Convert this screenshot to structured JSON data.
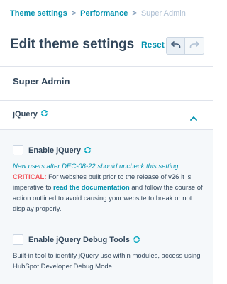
{
  "breadcrumb": {
    "items": [
      "Theme settings",
      "Performance",
      "Super Admin"
    ],
    "separator": ">"
  },
  "header": {
    "title": "Edit theme settings",
    "reset_label": "Reset",
    "undo_icon": "undo-icon",
    "redo_icon": "redo-icon"
  },
  "section": {
    "title": "Super Admin"
  },
  "accordion": {
    "label": "jQuery",
    "icon": "sync-icon",
    "chevron": "chevron-up-icon",
    "expanded": true
  },
  "options": [
    {
      "label": "Enable jQuery",
      "checked": false,
      "icon": "sync-icon"
    },
    {
      "label": "Enable jQuery Debug Tools",
      "checked": false,
      "icon": "sync-icon"
    }
  ],
  "jquery_desc": {
    "note": "New users after DEC-08-22 should uncheck this setting.",
    "critical_label": "CRITICAL:",
    "text_before_link": "For websites built prior to the release of v26 it is imperative to",
    "link_text": "read the documentation",
    "text_after_link": "and follow the course of action outlined to avoid causing your website to break or not display properly."
  },
  "debug_desc": {
    "text": "Built-in tool to identify jQuery use within modules, access using HubSpot Developer Debug Mode."
  },
  "colors": {
    "link": "#0091ae",
    "text": "#33475b",
    "critical": "#f2545b",
    "panel_bg": "#f5f8fa",
    "border": "#dfe3eb",
    "sync_icon": "#00a4bd"
  }
}
